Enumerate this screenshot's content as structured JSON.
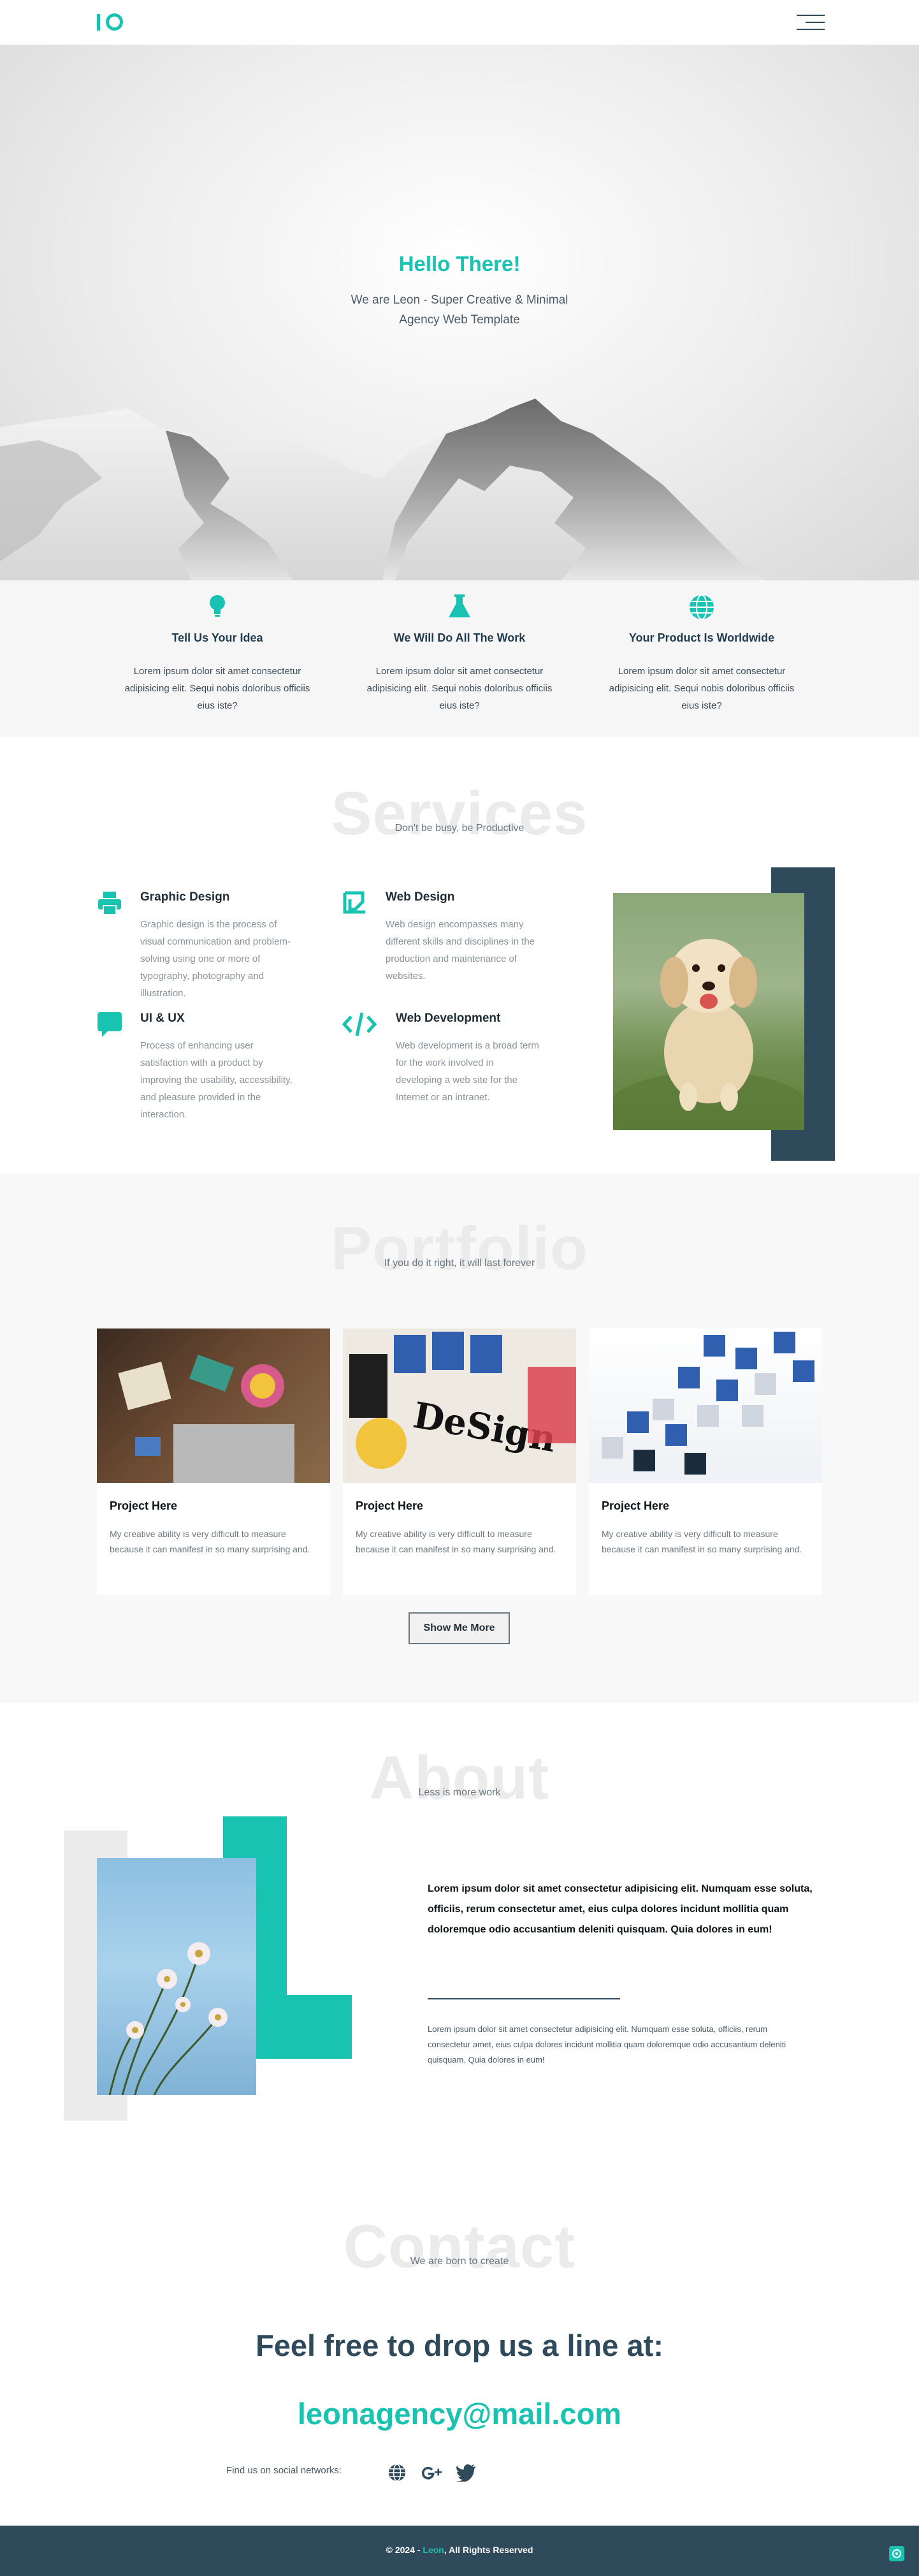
{
  "header": {
    "logo_text": "IO"
  },
  "hero": {
    "title": "Hello There!",
    "subtitle": "We are Leon - Super Creative & Minimal Agency Web Template"
  },
  "features": [
    {
      "icon": "lightbulb-icon",
      "title": "Tell Us Your Idea",
      "text": "Lorem ipsum dolor sit amet consectetur adipisicing elit. Sequi nobis doloribus officiis eius iste?"
    },
    {
      "icon": "flask-icon",
      "title": "We Will Do All The Work",
      "text": "Lorem ipsum dolor sit amet consectetur adipisicing elit. Sequi nobis doloribus officiis eius iste?"
    },
    {
      "icon": "globe-icon",
      "title": "Your Product Is Worldwide",
      "text": "Lorem ipsum dolor sit amet consectetur adipisicing elit. Sequi nobis doloribus officiis eius iste?"
    }
  ],
  "services": {
    "heading": "Services",
    "tagline": "Don't be busy, be Productive",
    "items": [
      {
        "icon": "printer-icon",
        "title": "Graphic Design",
        "text": "Graphic design is the process of visual communication and problem-solving using one or more of typography, photography and illustration."
      },
      {
        "icon": "crop-icon",
        "title": "Web Design",
        "text": "Web design encompasses many different skills and disciplines in the production and maintenance of websites."
      },
      {
        "icon": "chat-icon",
        "title": "UI & UX",
        "text": "Process of enhancing user satisfaction with a product by improving the usability, accessibility, and pleasure provided in the interaction."
      },
      {
        "icon": "code-icon",
        "title": "Web Development",
        "text": "Web development is a broad term for the work involved in developing a web site for the Internet or an intranet."
      }
    ]
  },
  "portfolio": {
    "heading": "Portfolio",
    "tagline": "If you do it right, it will last forever",
    "cards": [
      {
        "title": "Project Here",
        "text": "My creative ability is very difficult to measure because it can manifest in so many surprising and."
      },
      {
        "title": "Project Here",
        "text": "My creative ability is very difficult to measure because it can manifest in so many surprising and."
      },
      {
        "title": "Project Here",
        "text": "My creative ability is very difficult to measure because it can manifest in so many surprising and."
      }
    ],
    "more_button": "Show Me More"
  },
  "about": {
    "heading": "About",
    "tagline": "Less is more work",
    "lead": "Lorem ipsum dolor sit amet consectetur adipisicing elit. Numquam esse soluta, officiis, rerum consectetur amet, eius culpa dolores incidunt mollitia quam doloremque odio accusantium deleniti quisquam. Quia dolores in eum!",
    "body": "Lorem ipsum dolor sit amet consectetur adipisicing elit. Numquam esse soluta, officiis, rerum consectetur amet, eius culpa dolores incidunt mollitia quam doloremque odio accusantium deleniti quisquam. Quia dolores in eum!"
  },
  "contact": {
    "heading": "Contact",
    "tagline": "We are born to create",
    "headline": "Feel free to drop us a line at:",
    "email": "leonagency@mail.com",
    "social_label": "Find us on social networks:",
    "social": [
      "globe-icon",
      "google-plus-icon",
      "twitter-icon"
    ]
  },
  "footer": {
    "prefix": "© 2024 - ",
    "brand": "Leon",
    "suffix": ", All Rights Reserved"
  },
  "colors": {
    "accent": "#19c3b1",
    "dark": "#2e4a5b"
  }
}
